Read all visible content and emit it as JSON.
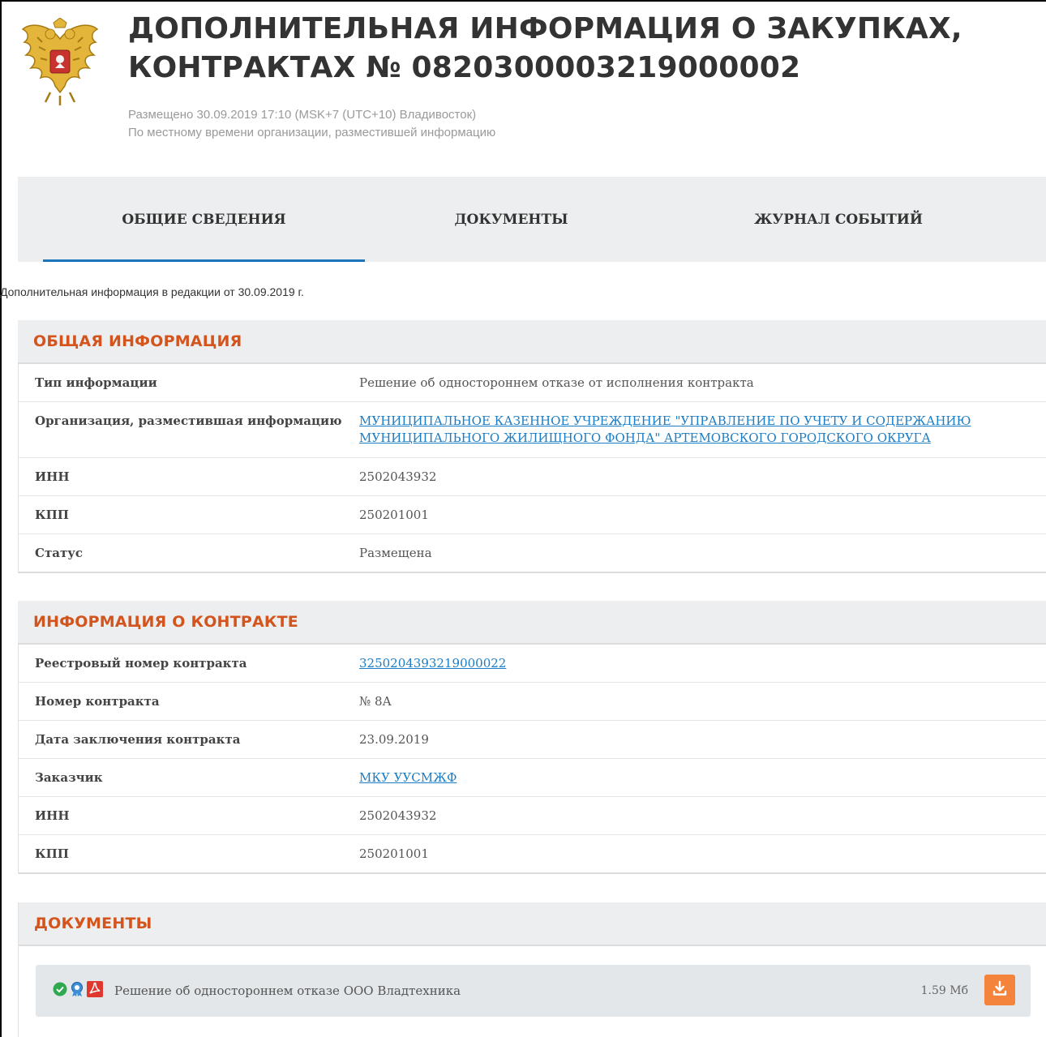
{
  "header": {
    "title_line1": "ДОПОЛНИТЕЛЬНАЯ ИНФОРМАЦИЯ О ЗАКУПКАХ,",
    "title_line2": "КОНТРАКТАХ № 0820300003219000002",
    "posted": "Размещено 30.09.2019 17:10 (MSK+7 (UTC+10) Владивосток)",
    "timezone_note": "По местному времени организации, разместившей информацию",
    "emblem_icon": "russian-coat-of-arms-icon"
  },
  "tabs": [
    {
      "label": "ОБЩИЕ СВЕДЕНИЯ",
      "active": true
    },
    {
      "label": "ДОКУМЕНТЫ",
      "active": false
    },
    {
      "label": "ЖУРНАЛ СОБЫТИЙ",
      "active": false
    }
  ],
  "edition_note": "Дополнительная информация в редакции от 30.09.2019 г.",
  "general": {
    "heading": "ОБЩАЯ ИНФОРМАЦИЯ",
    "rows": [
      {
        "label": "Тип информации",
        "value": "Решение об одностороннем отказе от исполнения контракта"
      },
      {
        "label": "Организация, разместившая информацию",
        "value_line1": "МУНИЦИПАЛЬНОЕ КАЗЕННОЕ УЧРЕЖДЕНИЕ \"УПРАВЛЕНИЕ ПО УЧЕТУ И СОДЕРЖАНИЮ",
        "value_line2": "МУНИЦИПАЛЬНОГО ЖИЛИЩНОГО ФОНДА\" АРТЕМОВСКОГО ГОРОДСКОГО ОКРУГА"
      },
      {
        "label": "ИНН",
        "value": "2502043932"
      },
      {
        "label": "КПП",
        "value": "250201001"
      },
      {
        "label": "Статус",
        "value": "Размещена"
      }
    ]
  },
  "contract": {
    "heading": "ИНФОРМАЦИЯ О КОНТРАКТЕ",
    "rows": [
      {
        "label": "Реестровый номер контракта",
        "value": "3250204393219000022"
      },
      {
        "label": "Номер контракта",
        "value": "№ 8А"
      },
      {
        "label": "Дата заключения контракта",
        "value": "23.09.2019"
      },
      {
        "label": "Заказчик",
        "value": "МКУ УУСМЖФ"
      },
      {
        "label": "ИНН",
        "value": "2502043932"
      },
      {
        "label": "КПП",
        "value": "250201001"
      }
    ]
  },
  "documents": {
    "heading": "ДОКУМЕНТЫ",
    "items": [
      {
        "name": "Решение об одностороннем отказе ООО Владтехника",
        "size": "1.59 Мб",
        "icons": [
          "check-circle-icon",
          "signature-badge-icon",
          "pdf-icon"
        ],
        "download_icon": "download-icon"
      }
    ]
  },
  "colors": {
    "accent_blue": "#1b75bb",
    "section_heading": "#d4541e",
    "download_button": "#f4843c",
    "check_green": "#2fa84f"
  }
}
